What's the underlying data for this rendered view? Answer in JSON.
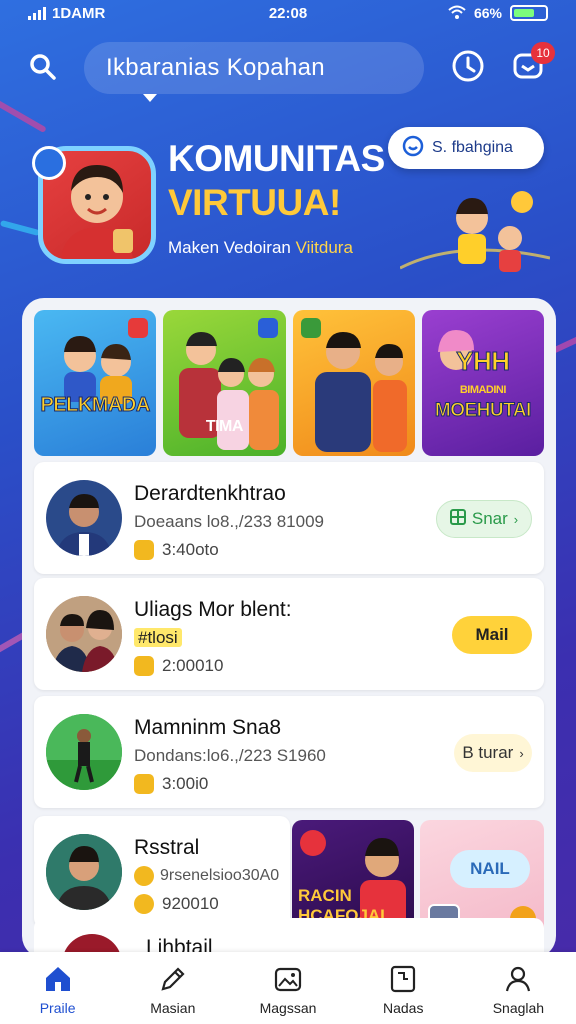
{
  "status": {
    "carrier": "1DAMR",
    "time": "22:08",
    "battery": "66%"
  },
  "header": {
    "title": "Ikbaranias Kopahan",
    "notification_count": "10"
  },
  "hero": {
    "title_line1": "KOMUNITAS",
    "title_line2": "VIRTUUA!",
    "subtitle_part1": "Maken Vedoiran ",
    "subtitle_part2": "Viitdura",
    "chip_label": "S. fbahgina"
  },
  "tiles": [
    {
      "label": "PELKMADA",
      "color": "#3aa6e8"
    },
    {
      "label": "TIMA",
      "color": "#7cc83a"
    },
    {
      "label": "",
      "color": "#f2a21a"
    },
    {
      "label_top": "YHH",
      "label_mid": "BIMADINI",
      "label_bottom": "MOEHUTAI",
      "color": "#7b2fb8"
    }
  ],
  "rows": [
    {
      "name": "Derardtenkhtrao",
      "sub": "Doeaans lo8.,/233 81009",
      "meta": "3:40oto",
      "button": "Snar",
      "button_style": "green"
    },
    {
      "name": "Uliags Mor blent:",
      "tag": "#tlosi",
      "meta": "2:00010",
      "button": "Mail",
      "button_style": "yellow"
    },
    {
      "name": "Mamninm Sna8",
      "sub": "Dondans:lo6.,/223 S1960",
      "meta": "3:00i0",
      "button": "B turar",
      "button_style": "pale"
    },
    {
      "name": "Rsstral",
      "sub": "9rsenelsioo30A0",
      "meta": "920010",
      "promo_label_top": "RACIN",
      "promo_label_bottom": "HCAFOJAI",
      "bubble": "NAIL"
    }
  ],
  "partial_row": {
    "name": "Lihbtail"
  },
  "nav": [
    {
      "label": "Praile",
      "icon": "home-icon",
      "active": true
    },
    {
      "label": "Masian",
      "icon": "edit-icon",
      "active": false
    },
    {
      "label": "Magssan",
      "icon": "gallery-icon",
      "active": false
    },
    {
      "label": "Nadas",
      "icon": "document-icon",
      "active": false
    },
    {
      "label": "Snaglah",
      "icon": "profile-icon",
      "active": false
    }
  ],
  "colors": {
    "accent": "#1f4fd0",
    "hero_yellow": "#ffc93a",
    "badge_red": "#e6323c"
  }
}
